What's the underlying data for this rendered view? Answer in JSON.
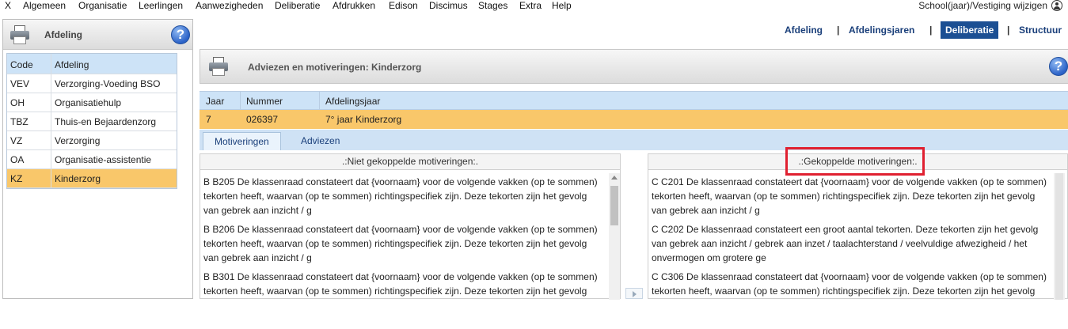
{
  "menubar": {
    "items": [
      "X",
      "Algemeen",
      "Organisatie",
      "Leerlingen",
      "Aanwezigheden",
      "Deliberatie",
      "Afdrukken",
      "Edison",
      "Discimus",
      "Stages",
      "Extra",
      "Help"
    ],
    "right_link": "School(jaar)/Vestiging wijzigen"
  },
  "left_panel": {
    "title": "Afdeling",
    "help": "?",
    "columns": [
      "Code",
      "Afdeling"
    ],
    "rows": [
      {
        "code": "VEV",
        "name": "Verzorging-Voeding BSO"
      },
      {
        "code": "OH",
        "name": "Organisatiehulp"
      },
      {
        "code": "TBZ",
        "name": "Thuis-en Bejaardenzorg"
      },
      {
        "code": "VZ",
        "name": "Verzorging"
      },
      {
        "code": "OA",
        "name": "Organisatie-assistentie"
      },
      {
        "code": "KZ",
        "name": "Kinderzorg"
      }
    ]
  },
  "top_tabs": [
    "Afdeling",
    "Afdelingsjaren",
    "Deliberatie",
    "Structuur"
  ],
  "main": {
    "title": "Adviezen en motiveringen: Kinderzorg",
    "help": "?",
    "columns": [
      "Jaar",
      "Nummer",
      "Afdelingsjaar"
    ],
    "row": {
      "jaar": "7",
      "nummer": "026397",
      "afdelingsjaar": "7° jaar Kinderzorg"
    },
    "subtabs": [
      "Motiveringen",
      "Adviezen"
    ],
    "left_list": {
      "header": ".:Niet gekoppelde motiveringen:.",
      "items": [
        [
          "B B205 De klassenraad constateert dat {voornaam} voor de volgende vakken (op te sommen)",
          "tekorten heeft, waarvan (op te sommen) richtingspecifiek zijn. Deze tekorten zijn het gevolg",
          "van gebrek aan inzicht / g"
        ],
        [
          "B B206 De klassenraad constateert dat {voornaam} voor de volgende vakken (op te sommen)",
          "tekorten heeft, waarvan (op te sommen) richtingspecifiek zijn. Deze tekorten zijn het gevolg",
          "van gebrek aan inzicht / g"
        ],
        [
          "B B301 De klassenraad constateert dat {voornaam} voor de volgende vakken (op te sommen)",
          "tekorten heeft, waarvan (op te sommen) richtingspecifiek zijn. Deze tekorten zijn het gevolg"
        ]
      ]
    },
    "right_list": {
      "header": ".:Gekoppelde motiveringen:.",
      "items": [
        [
          "C C201 De klassenraad constateert dat {voornaam} voor de volgende vakken (op te sommen)",
          "tekorten heeft, waarvan (op te sommen) richtingspecifiek zijn. Deze tekorten zijn het gevolg",
          "van gebrek aan inzicht / g"
        ],
        [
          "C C202 De klassenraad constateert een groot aantal tekorten. Deze tekorten zijn het gevolg",
          "van gebrek aan inzicht / gebrek aan inzet / taalachterstand / veelvuldige afwezigheid / het",
          "onvermogen om grotere ge"
        ],
        [
          "C C306 De klassenraad constateert dat {voornaam} voor de volgende vakken (op te sommen)",
          "tekorten heeft, waarvan (op te sommen) richtingspecifiek zijn. Deze tekorten zijn het gevolg"
        ]
      ]
    }
  },
  "colors": {
    "selection": "#f9c76a",
    "header_blue": "#cde3f7",
    "active_tab": "#1b4f93",
    "highlight": "#e02030"
  }
}
